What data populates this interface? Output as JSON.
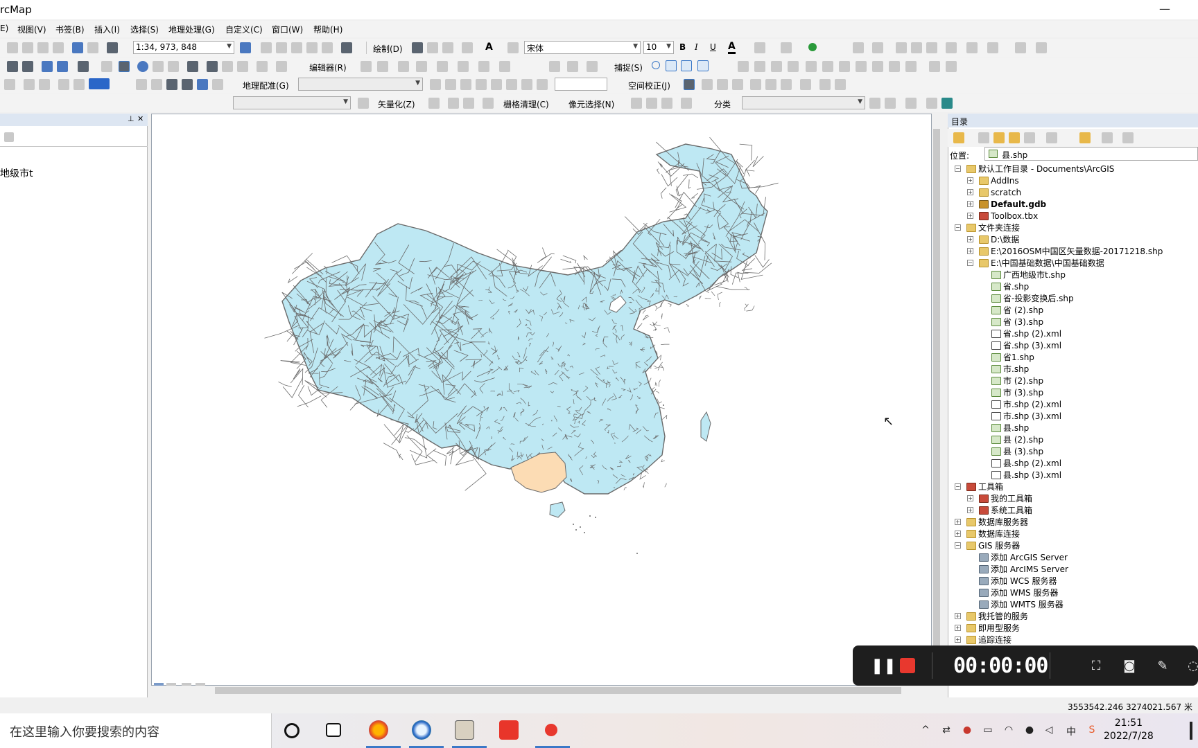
{
  "app": {
    "title": "rcMap"
  },
  "window": {
    "minimize_glyph": "—"
  },
  "menu": [
    "E)",
    "视图(V)",
    "书签(B)",
    "插入(I)",
    "选择(S)",
    "地理处理(G)",
    "自定义(C)",
    "窗口(W)",
    "帮助(H)"
  ],
  "toolbar": {
    "scale_value": "1:34, 973, 848",
    "draw_label": "绘制(D)",
    "font_name": "宋体",
    "font_size": "10",
    "bold": "B",
    "italic": "I",
    "underline": "U",
    "font_color_glyph": "A",
    "editor_label": "编辑器(R)",
    "snapping_label": "捕捉(S)",
    "georef_label": "地理配准(G)",
    "spatial_adjust_label": "空间校正(J)",
    "vectorize_label": "矢量化(Z)",
    "raster_cleanup_label": "栅格清理(C)",
    "cell_select_label": "像元选择(N)",
    "classify_label": "分类"
  },
  "toc": {
    "pin_glyph": "⊥",
    "close_glyph": "✕",
    "layer_label": "地级市t"
  },
  "map": {
    "country_fill": "#bee8f3",
    "highlight_fill": "#fcdcb4",
    "boundary_color": "#6a6a6a"
  },
  "catalog": {
    "header": "目录",
    "location_label": "位置:",
    "location_value": "县.shp",
    "tree": [
      {
        "label": "默认工作目录 - Documents\\ArcGIS",
        "level": 0,
        "icon": "folder-home",
        "expander": "−"
      },
      {
        "label": "AddIns",
        "level": 1,
        "icon": "folder",
        "expander": "+"
      },
      {
        "label": "scratch",
        "level": 1,
        "icon": "folder",
        "expander": "+"
      },
      {
        "label": "Default.gdb",
        "level": 1,
        "icon": "gdb",
        "expander": "+",
        "bold": true
      },
      {
        "label": "Toolbox.tbx",
        "level": 1,
        "icon": "tbx",
        "expander": "+"
      },
      {
        "label": "文件夹连接",
        "level": 0,
        "icon": "folder",
        "expander": "−"
      },
      {
        "label": "D:\\数据",
        "level": 1,
        "icon": "folder",
        "expander": "+"
      },
      {
        "label": "E:\\2016OSM中国区矢量数据-20171218.shp",
        "level": 1,
        "icon": "folder",
        "expander": "+"
      },
      {
        "label": "E:\\中国基础数据\\中国基础数据",
        "level": 1,
        "icon": "folder",
        "expander": "−"
      },
      {
        "label": "广西地级市t.shp",
        "level": 2,
        "icon": "shp",
        "expander": ""
      },
      {
        "label": "省.shp",
        "level": 2,
        "icon": "shp",
        "expander": ""
      },
      {
        "label": "省-投影变换后.shp",
        "level": 2,
        "icon": "shp",
        "expander": ""
      },
      {
        "label": "省 (2).shp",
        "level": 2,
        "icon": "shp",
        "expander": ""
      },
      {
        "label": "省 (3).shp",
        "level": 2,
        "icon": "shp",
        "expander": ""
      },
      {
        "label": "省.shp (2).xml",
        "level": 2,
        "icon": "xml",
        "expander": ""
      },
      {
        "label": "省.shp (3).xml",
        "level": 2,
        "icon": "xml",
        "expander": ""
      },
      {
        "label": "省1.shp",
        "level": 2,
        "icon": "shp",
        "expander": ""
      },
      {
        "label": "市.shp",
        "level": 2,
        "icon": "shp",
        "expander": ""
      },
      {
        "label": "市 (2).shp",
        "level": 2,
        "icon": "shp",
        "expander": ""
      },
      {
        "label": "市 (3).shp",
        "level": 2,
        "icon": "shp",
        "expander": ""
      },
      {
        "label": "市.shp (2).xml",
        "level": 2,
        "icon": "xml",
        "expander": ""
      },
      {
        "label": "市.shp (3).xml",
        "level": 2,
        "icon": "xml",
        "expander": ""
      },
      {
        "label": "县.shp",
        "level": 2,
        "icon": "shp",
        "expander": ""
      },
      {
        "label": "县 (2).shp",
        "level": 2,
        "icon": "shp",
        "expander": ""
      },
      {
        "label": "县 (3).shp",
        "level": 2,
        "icon": "shp",
        "expander": ""
      },
      {
        "label": "县.shp (2).xml",
        "level": 2,
        "icon": "xml",
        "expander": ""
      },
      {
        "label": "县.shp (3).xml",
        "level": 2,
        "icon": "xml",
        "expander": ""
      },
      {
        "label": "工具箱",
        "level": 0,
        "icon": "tbx",
        "expander": "−"
      },
      {
        "label": "我的工具箱",
        "level": 1,
        "icon": "tbx",
        "expander": "+"
      },
      {
        "label": "系统工具箱",
        "level": 1,
        "icon": "tbx",
        "expander": "+"
      },
      {
        "label": "数据库服务器",
        "level": 0,
        "icon": "folder",
        "expander": "+"
      },
      {
        "label": "数据库连接",
        "level": 0,
        "icon": "folder",
        "expander": "+"
      },
      {
        "label": "GIS 服务器",
        "level": 0,
        "icon": "folder",
        "expander": "−"
      },
      {
        "label": "添加 ArcGIS Server",
        "level": 1,
        "icon": "server",
        "expander": ""
      },
      {
        "label": "添加 ArcIMS Server",
        "level": 1,
        "icon": "server",
        "expander": ""
      },
      {
        "label": "添加 WCS 服务器",
        "level": 1,
        "icon": "server",
        "expander": ""
      },
      {
        "label": "添加 WMS 服务器",
        "level": 1,
        "icon": "server",
        "expander": ""
      },
      {
        "label": "添加 WMTS 服务器",
        "level": 1,
        "icon": "server",
        "expander": ""
      },
      {
        "label": "我托管的服务",
        "level": 0,
        "icon": "folder",
        "expander": "+"
      },
      {
        "label": "即用型服务",
        "level": 0,
        "icon": "folder",
        "expander": "+"
      },
      {
        "label": "追踪连接",
        "level": 0,
        "icon": "folder",
        "expander": "+"
      }
    ]
  },
  "status": {
    "coordinates": "3553542.246  3274021.567 米"
  },
  "recorder": {
    "time": "00:00:00"
  },
  "taskbar": {
    "search_placeholder": "在这里输入你要搜索的内容",
    "clock_time": "21:51",
    "clock_date": "2022/7/28",
    "ime_label": "中"
  }
}
